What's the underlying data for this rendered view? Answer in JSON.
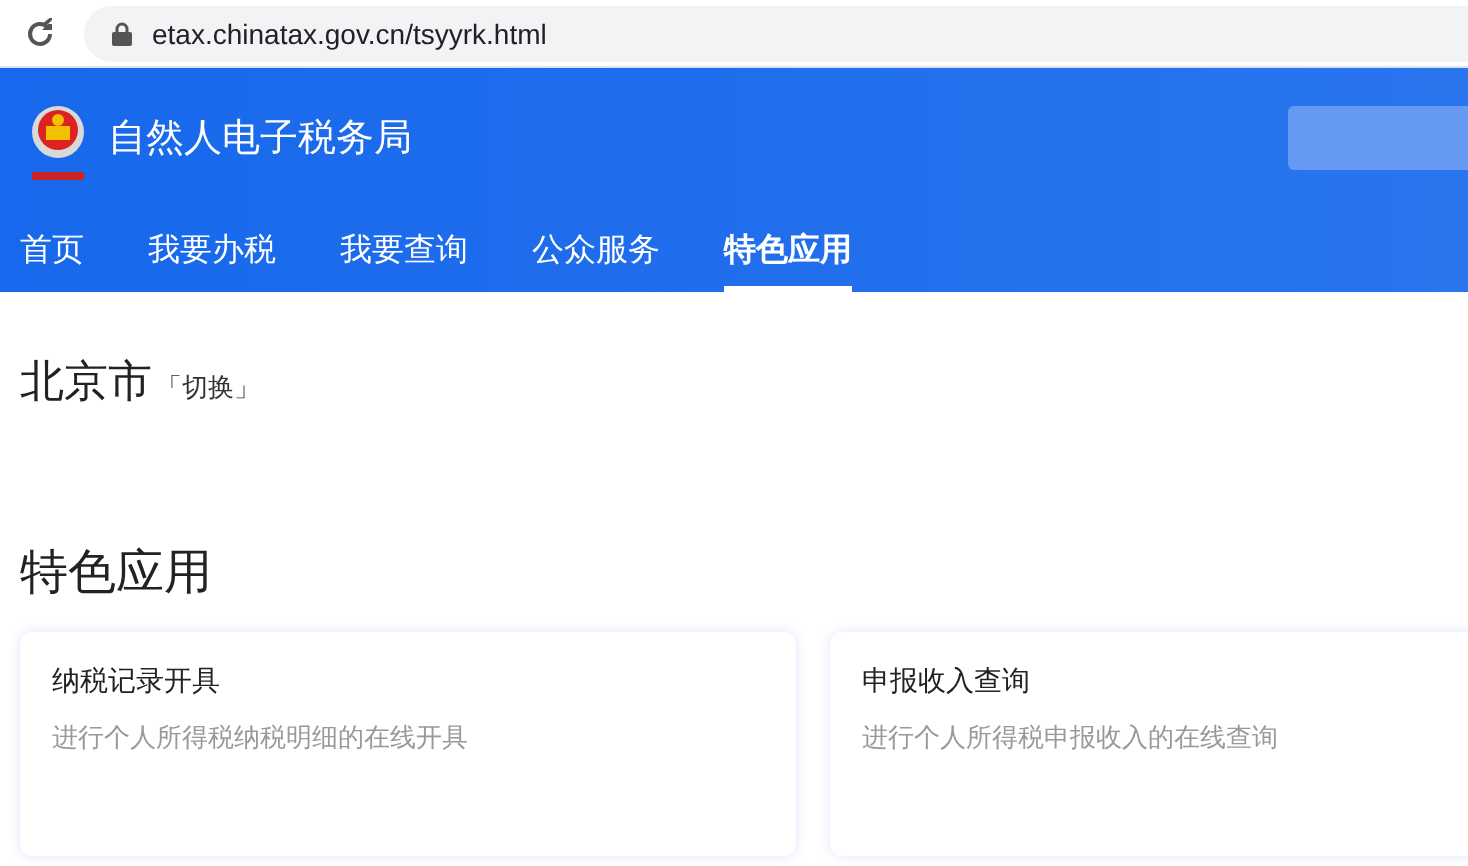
{
  "browser": {
    "url": "etax.chinatax.gov.cn/tsyyrk.html"
  },
  "header": {
    "site_title": "自然人电子税务局"
  },
  "nav": [
    {
      "label": "首页",
      "selected": false
    },
    {
      "label": "我要办税",
      "selected": false
    },
    {
      "label": "我要查询",
      "selected": false
    },
    {
      "label": "公众服务",
      "selected": false
    },
    {
      "label": "特色应用",
      "selected": true
    }
  ],
  "region": {
    "city": "北京市",
    "switch_link": "「切换」"
  },
  "section_title": "特色应用",
  "cards": [
    {
      "title": "纳税记录开具",
      "description": "进行个人所得税纳税明细的在线开具"
    },
    {
      "title": "申报收入查询",
      "description": "进行个人所得税申报收入的在线查询"
    }
  ]
}
